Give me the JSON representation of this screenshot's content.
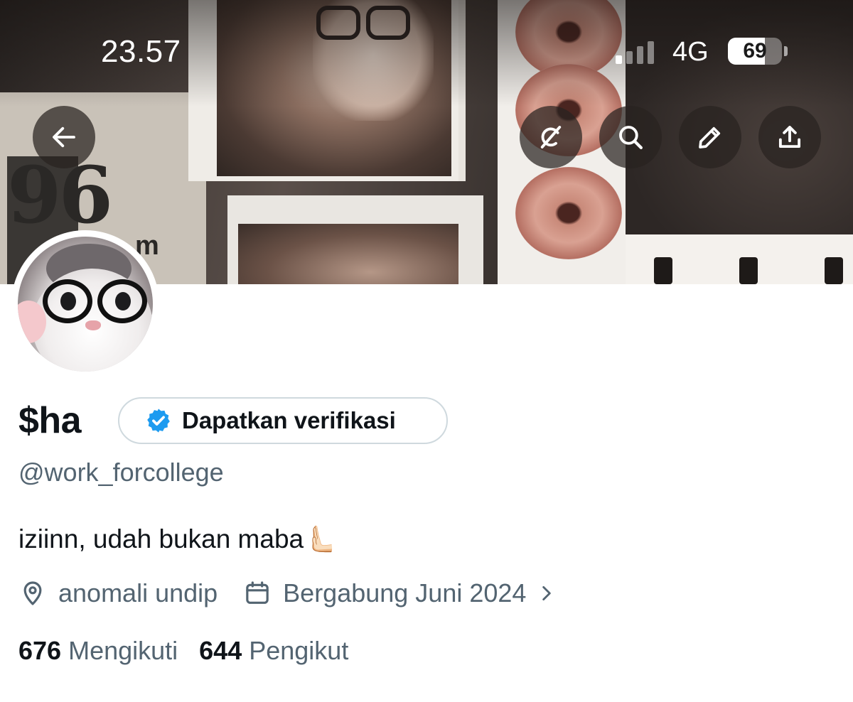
{
  "status_bar": {
    "time": "23.57",
    "network": "4G",
    "battery": "69",
    "battery_level": 0.69
  },
  "top_actions": {
    "back_icon": "arrow-left-icon",
    "grok_icon": "grok-icon",
    "search_icon": "search-icon",
    "edit_icon": "pencil-icon",
    "share_icon": "share-icon"
  },
  "profile": {
    "display_name": "$ha",
    "verify_label": "Dapatkan verifikasi",
    "handle": "@work_forcollege",
    "bio": "iziinn, udah bukan maba🫷🏻",
    "location": "anomali undip",
    "joined": "Bergabung Juni 2024",
    "following_count": "676",
    "following_label": "Mengikuti",
    "followers_count": "644",
    "followers_label": "Pengikut"
  },
  "colors": {
    "text_primary": "#0f1419",
    "text_secondary": "#536471",
    "verified_blue": "#1d9bf0",
    "button_border": "#cfd9de"
  }
}
